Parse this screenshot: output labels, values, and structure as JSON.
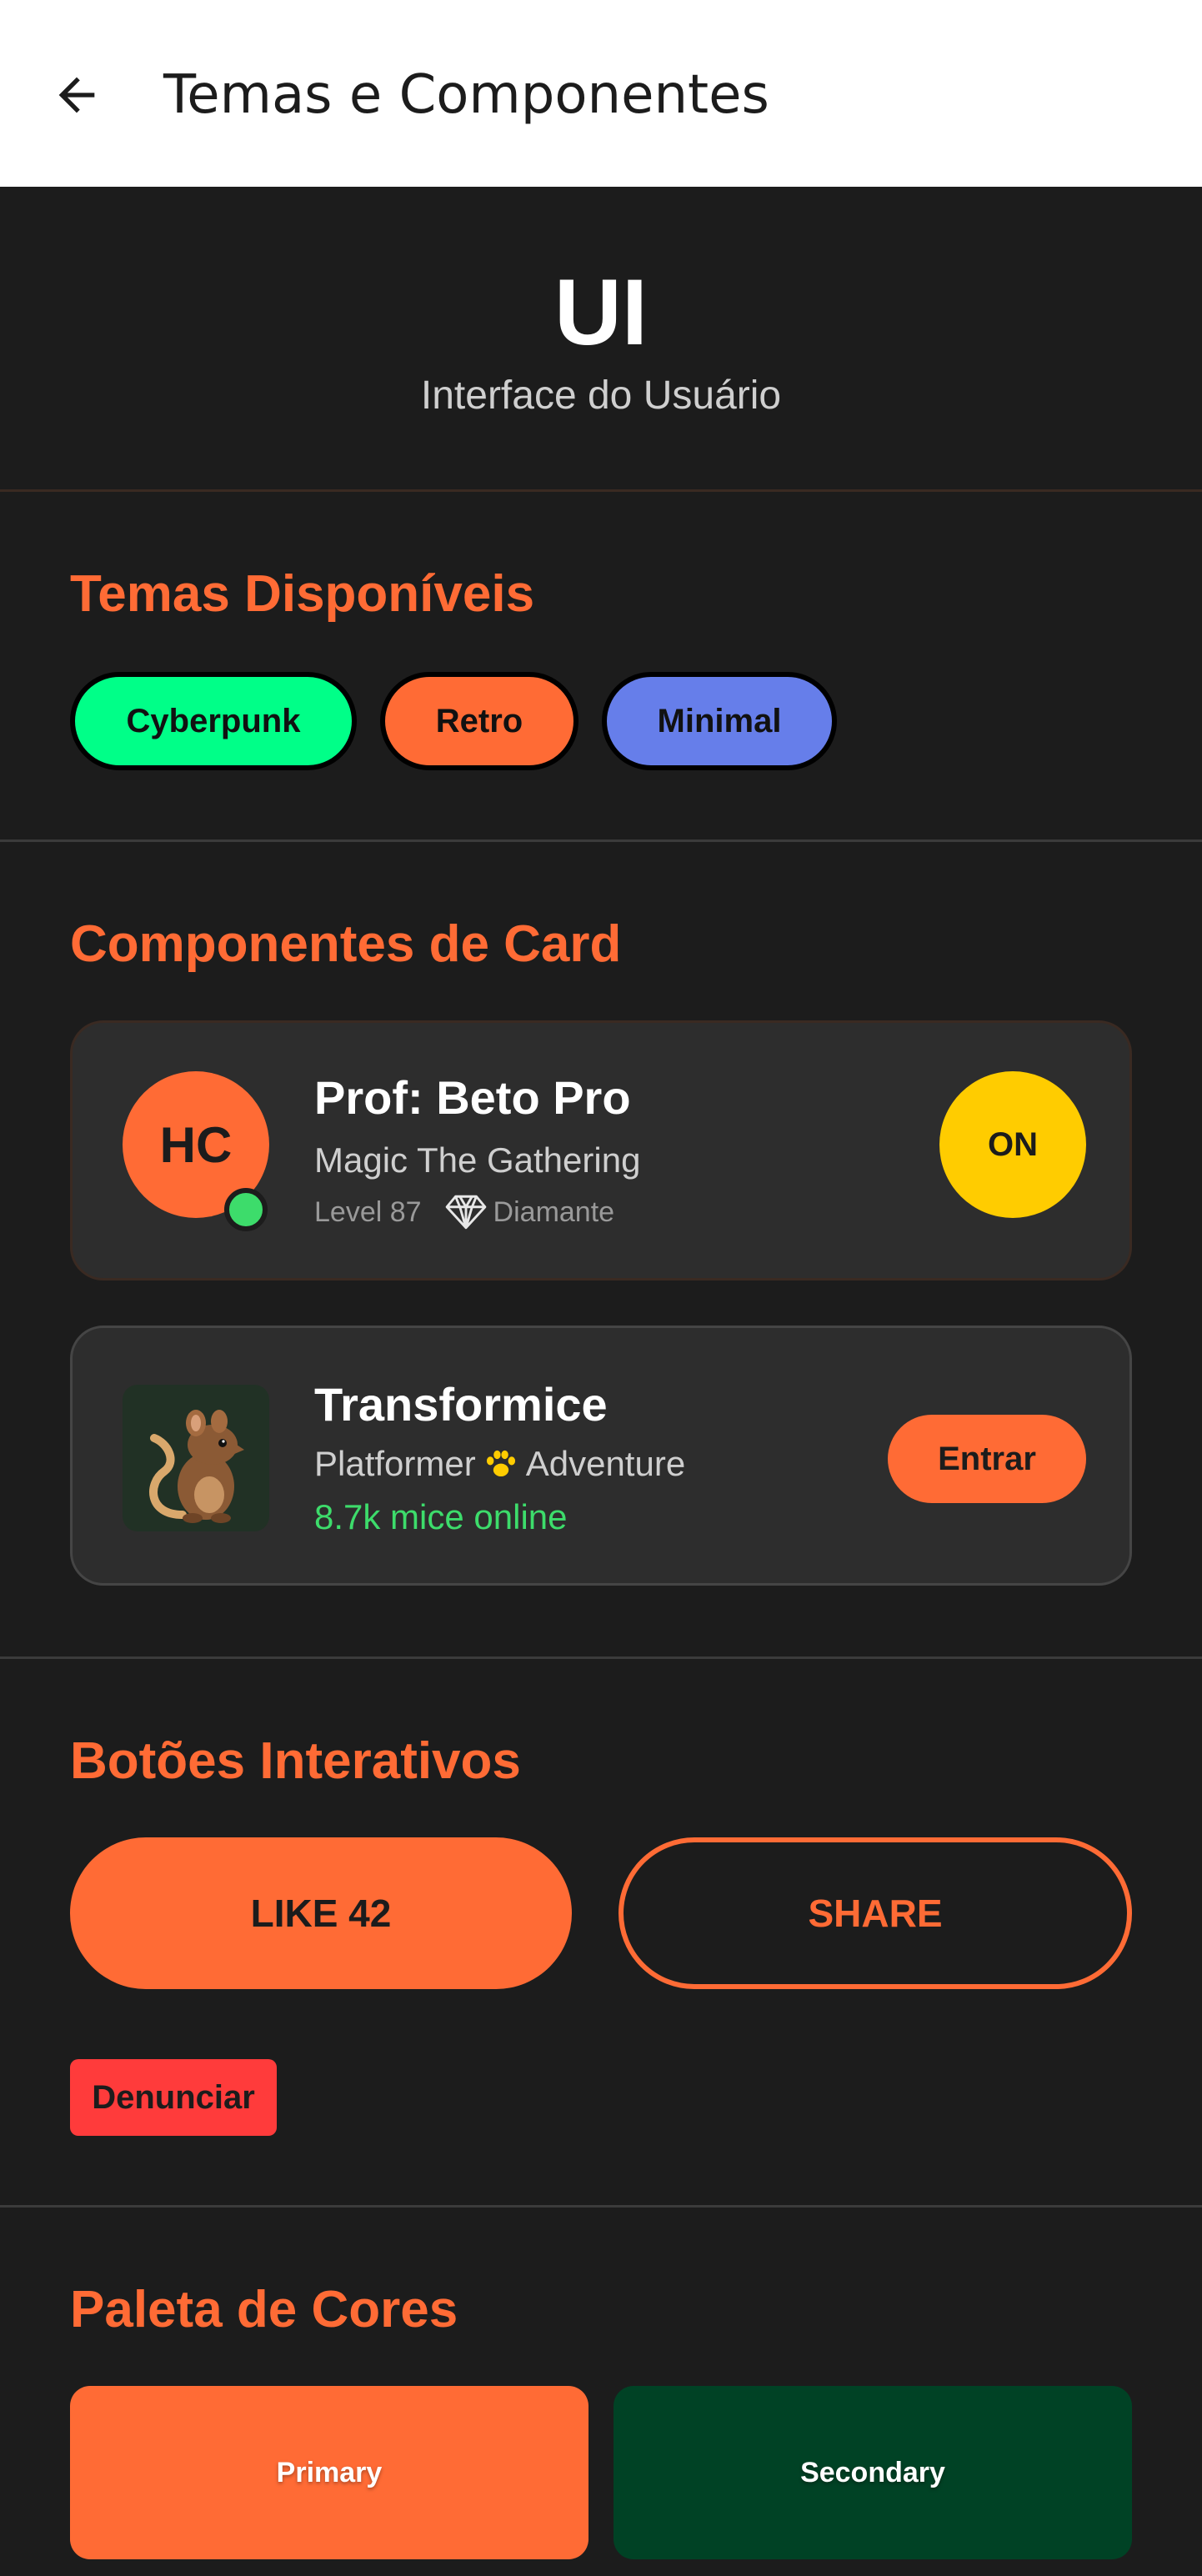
{
  "appbar": {
    "title": "Temas e Componentes",
    "back_icon": "arrow-left-icon"
  },
  "hero": {
    "title": "UI",
    "subtitle": "Interface do Usuário"
  },
  "themes": {
    "title": "Temas Disponíveis",
    "chips": [
      {
        "label": "Cyberpunk",
        "color": "#00ff88"
      },
      {
        "label": "Retro",
        "color": "#ff6b35"
      },
      {
        "label": "Minimal",
        "color": "#667eea"
      }
    ]
  },
  "cards": {
    "title": "Componentes de Card",
    "profile": {
      "initials": "HC",
      "name": "Prof: Beto Pro",
      "game": "Magic The Gathering",
      "level": "Level 87",
      "rank_icon": "diamond-icon",
      "rank": "Diamante",
      "toggle": "ON"
    },
    "game": {
      "image_icon": "mouse-icon",
      "name": "Transformice",
      "genre_a": "Platformer",
      "genre_icon": "paw-icon",
      "genre_b": "Adventure",
      "online": "8.7k mice online",
      "action": "Entrar"
    }
  },
  "buttons": {
    "title": "Botões Interativos",
    "like": "LIKE 42",
    "share": "SHARE",
    "report": "Denunciar"
  },
  "palette": {
    "title": "Paleta de Cores",
    "swatches": [
      {
        "label": "Primary",
        "color": "#ff6b35"
      },
      {
        "label": "Secondary",
        "color": "#004225"
      }
    ]
  },
  "colors": {
    "accent": "#ff6b35",
    "background": "#1c1c1c",
    "card": "#2d2d2d",
    "online": "#3ddc6b",
    "warning": "#ffcc00",
    "danger": "#ff3b3b"
  }
}
